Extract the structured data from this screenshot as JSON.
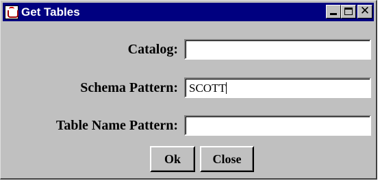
{
  "window": {
    "title": "Get Tables",
    "controls": {
      "minimize_icon": "minimize-icon",
      "maximize_icon": "maximize-icon",
      "close_icon": "close-icon",
      "close_glyph": "✕"
    }
  },
  "form": {
    "catalog_label": "Catalog:",
    "catalog_value": "",
    "schema_label": "Schema Pattern:",
    "schema_value": "SCOTT",
    "table_label": "Table Name Pattern:",
    "table_value": ""
  },
  "buttons": {
    "ok_label": "Ok",
    "close_label": "Close"
  },
  "colors": {
    "titlebar": "#000080",
    "window_bg": "#c0c0c0"
  }
}
